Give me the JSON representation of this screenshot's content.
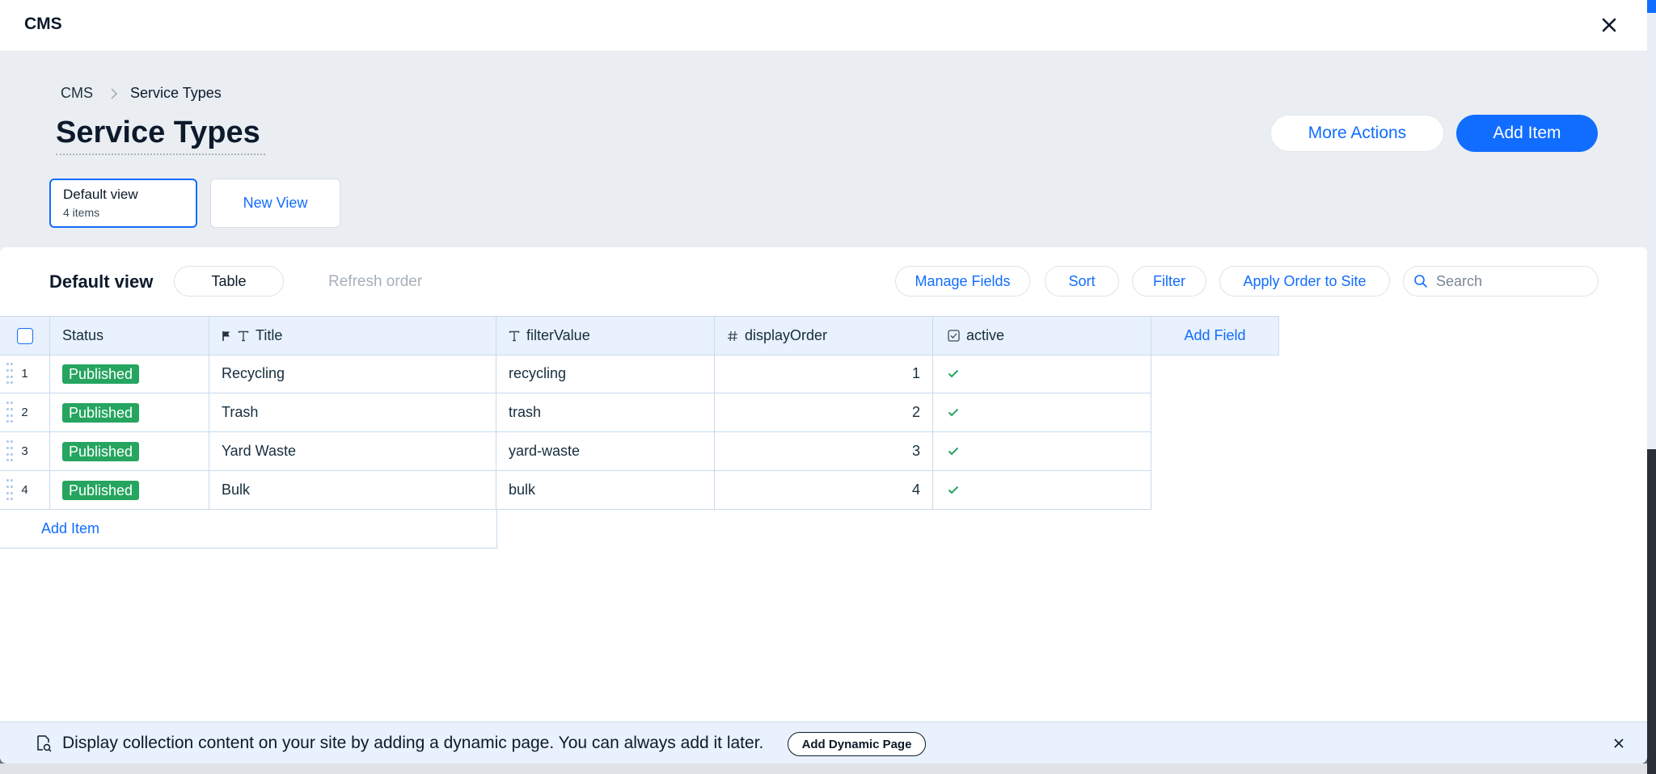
{
  "topbar": {
    "title": "CMS"
  },
  "breadcrumb": {
    "root": "CMS",
    "current": "Service Types"
  },
  "page": {
    "title": "Service Types"
  },
  "actions": {
    "more": "More Actions",
    "add": "Add Item"
  },
  "views": [
    {
      "name": "Default view",
      "count": "4 items"
    },
    {
      "name": "New View"
    }
  ],
  "toolbar": {
    "title": "Default view",
    "layout": "Table",
    "refresh": "Refresh order",
    "manage": "Manage Fields",
    "sort": "Sort",
    "filter": "Filter",
    "apply": "Apply Order to Site",
    "search_placeholder": "Search"
  },
  "columns": {
    "status": "Status",
    "title": "Title",
    "filterValue": "filterValue",
    "displayOrder": "displayOrder",
    "active": "active",
    "add_field": "Add Field"
  },
  "rows": [
    {
      "num": "1",
      "status": "Published",
      "title": "Recycling",
      "filterValue": "recycling",
      "displayOrder": "1",
      "active": true
    },
    {
      "num": "2",
      "status": "Published",
      "title": "Trash",
      "filterValue": "trash",
      "displayOrder": "2",
      "active": true
    },
    {
      "num": "3",
      "status": "Published",
      "title": "Yard Waste",
      "filterValue": "yard-waste",
      "displayOrder": "3",
      "active": true
    },
    {
      "num": "4",
      "status": "Published",
      "title": "Bulk",
      "filterValue": "bulk",
      "displayOrder": "4",
      "active": true
    }
  ],
  "table": {
    "add_item": "Add Item"
  },
  "banner": {
    "text": "Display collection content on your site by adding a dynamic page. You can always add it later.",
    "button": "Add Dynamic Page"
  },
  "colors": {
    "accent": "#116dff",
    "published": "#25a55f",
    "check": "#25a55f"
  },
  "icons": [
    "close-icon",
    "chevron-right-icon",
    "flag-icon",
    "text-icon",
    "hash-icon",
    "checkbox-icon",
    "search-icon",
    "drag-handle-icon",
    "check-icon",
    "page-icon"
  ]
}
